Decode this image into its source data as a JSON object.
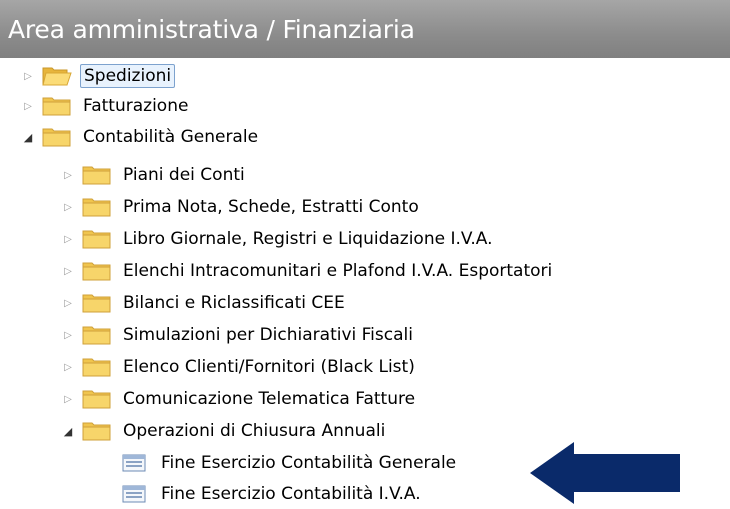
{
  "window": {
    "title": "Area amministrativa / Finanziaria"
  },
  "tree": {
    "spedizioni": "Spedizioni",
    "fatturazione": "Fatturazione",
    "contabilita_generale": "Contabilità Generale",
    "children": {
      "piani_conti": "Piani dei Conti",
      "prima_nota": "Prima Nota, Schede, Estratti Conto",
      "libro_giornale": "Libro Giornale, Registri e Liquidazione I.V.A.",
      "elenchi_intra": "Elenchi Intracomunitari e Plafond I.V.A. Esportatori",
      "bilanci": "Bilanci e Riclassificati CEE",
      "simulazioni": "Simulazioni per Dichiarativi Fiscali",
      "elenco_clienti": "Elenco Clienti/Fornitori (Black List)",
      "comunicazione": "Comunicazione Telematica Fatture",
      "operazioni_chiusura": "Operazioni di Chiusura Annuali"
    },
    "leaves": {
      "fine_generale": "Fine Esercizio Contabilità Generale",
      "fine_iva": "Fine Esercizio Contabilità I.V.A."
    }
  },
  "colors": {
    "arrow": "#0a2a6a",
    "folder": "#f2c94c",
    "selection": "#e8f2fd"
  }
}
